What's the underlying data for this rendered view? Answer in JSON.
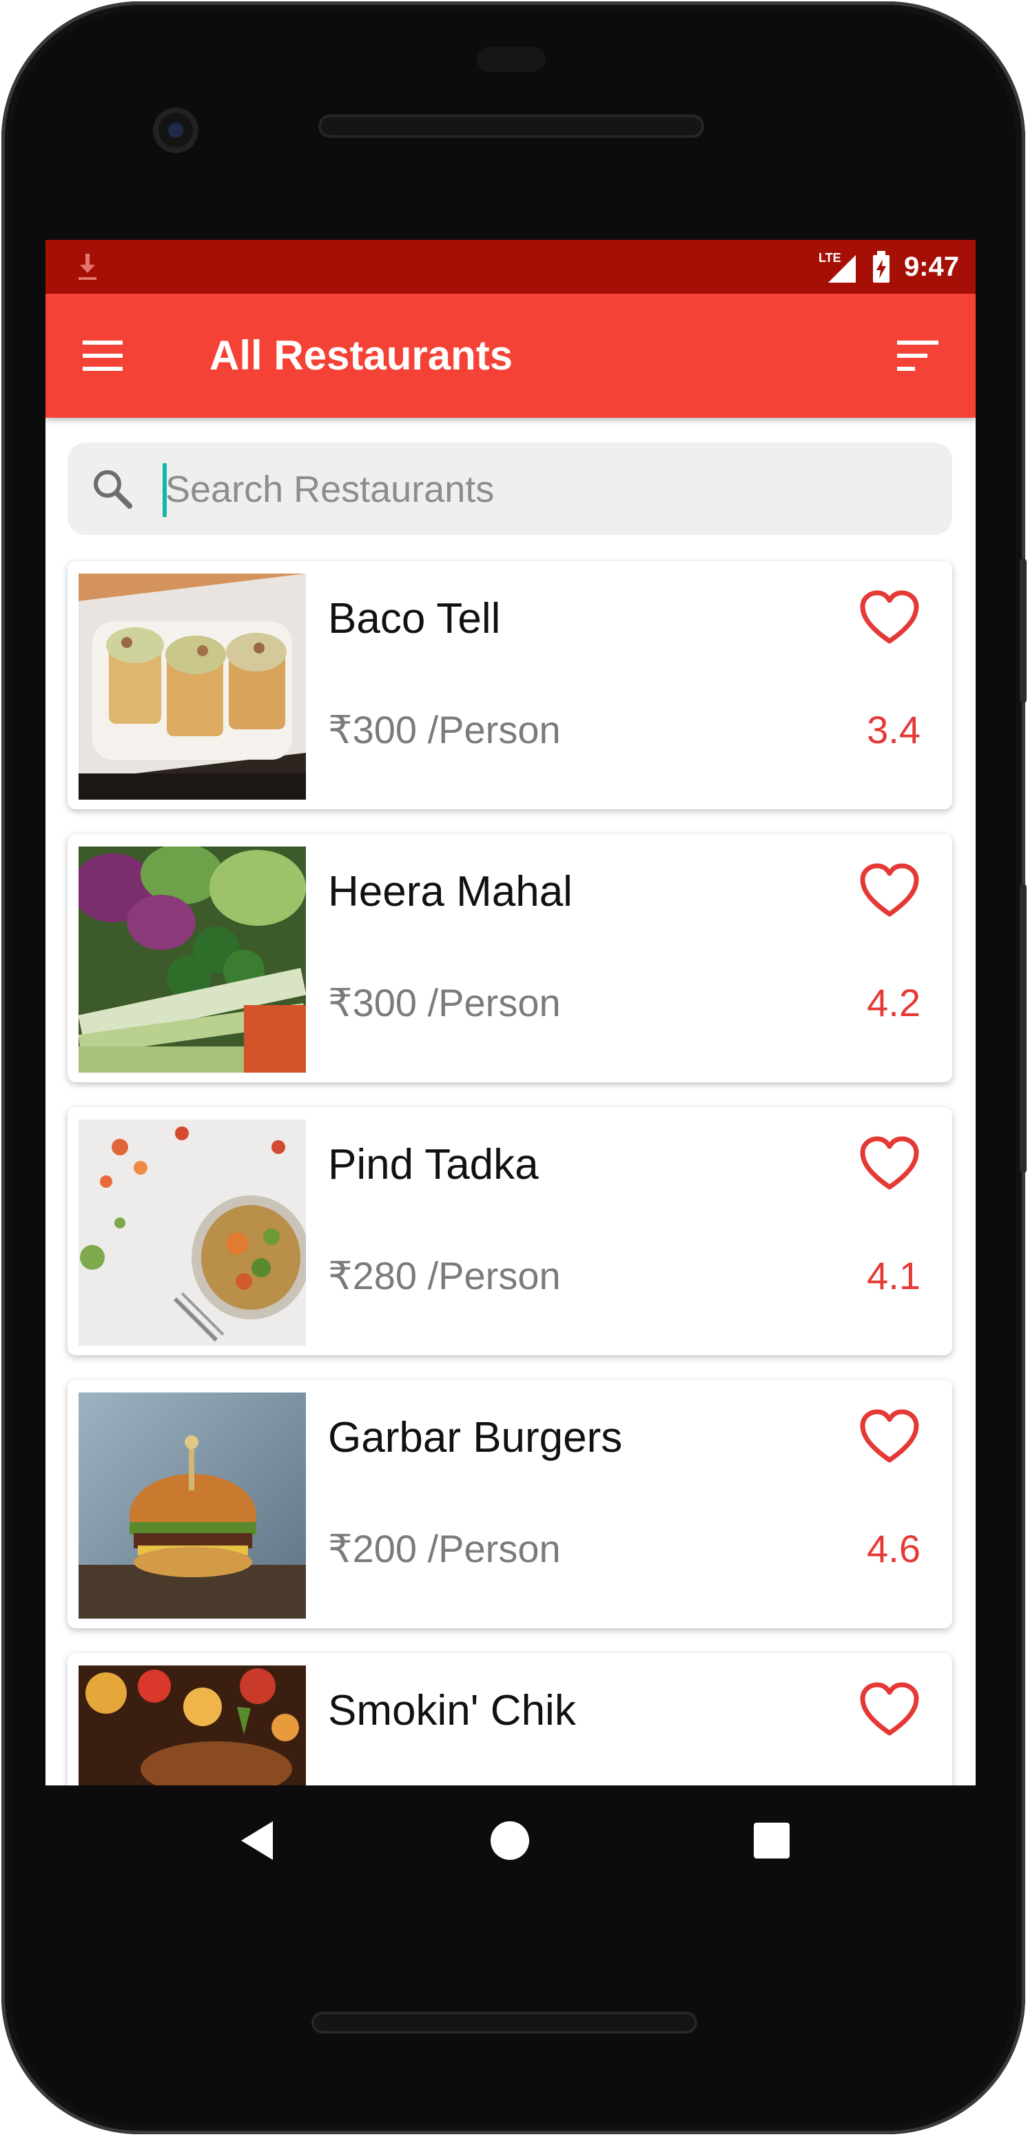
{
  "status_bar": {
    "time": "9:47",
    "network": "LTE",
    "download_icon": "download-icon"
  },
  "app_bar": {
    "title": "All Restaurants",
    "menu_icon": "menu-icon",
    "sort_icon": "sort-icon"
  },
  "search": {
    "placeholder": "Search Restaurants",
    "value": ""
  },
  "restaurants": [
    {
      "name": "Baco Tell",
      "price": "₹300 /Person",
      "rating": "3.4"
    },
    {
      "name": "Heera Mahal",
      "price": "₹300 /Person",
      "rating": "4.2"
    },
    {
      "name": "Pind Tadka",
      "price": "₹280 /Person",
      "rating": "4.1"
    },
    {
      "name": "Garbar Burgers",
      "price": "₹200 /Person",
      "rating": "4.6"
    },
    {
      "name": "Smokin' Chik",
      "price": "",
      "rating": ""
    }
  ],
  "colors": {
    "primary": "#f44336",
    "status_bar": "#a50f05",
    "accent_text": "#e53935",
    "cursor": "#12b5a7"
  },
  "system_nav": {
    "back_icon": "back-triangle-icon",
    "home_icon": "home-circle-icon",
    "recents_icon": "recents-square-icon"
  }
}
